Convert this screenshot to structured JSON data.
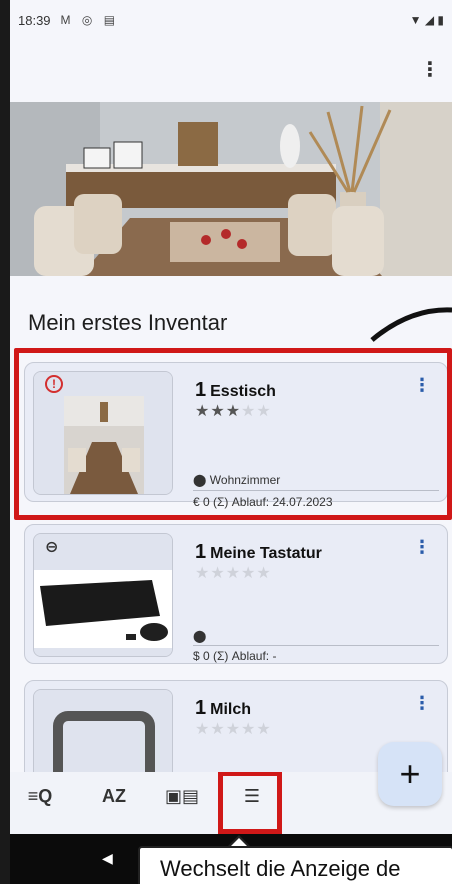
{
  "status_bar": {
    "time": "18:39",
    "notification_icons": [
      "gmail-icon",
      "alert-circle-icon",
      "calendar-icon"
    ],
    "system_icons": [
      "wifi-icon",
      "signal-icon",
      "battery-icon"
    ]
  },
  "app_bar": {
    "menu_icon": "more-vert-icon"
  },
  "title": "Mein erstes Inventar",
  "items": [
    {
      "count": "1",
      "name": "Esstisch",
      "rating": 3,
      "max_rating": 5,
      "badge": "alert-icon",
      "location": "Wohnzimmer",
      "meta": "€ 0  (Σ)   Ablauf: 24.07.2023"
    },
    {
      "count": "1",
      "name": "Meine Tastatur",
      "rating": 0,
      "max_rating": 5,
      "badge": "link-icon",
      "location": "",
      "meta": "$ 0  (Σ)   Ablauf: -"
    },
    {
      "count": "1",
      "name": "Milch",
      "rating": 0,
      "max_rating": 5,
      "badge": ""
    }
  ],
  "fab": {
    "label": "+"
  },
  "bottom_bar": {
    "items": [
      {
        "label": "≡Q",
        "icon": "filter-search-icon"
      },
      {
        "label": "AZ",
        "icon": "sort-az-icon"
      },
      {
        "label": "▣▤",
        "icon": "view-gallery-icon"
      },
      {
        "label": "☰",
        "icon": "view-list-icon"
      }
    ]
  },
  "tooltip": {
    "text": "Wechselt die Anzeige de"
  },
  "colors": {
    "highlight": "#d01818",
    "accent": "#2a5caa",
    "card_bg": "#e9ecf6",
    "fab_bg": "#d6e3f7"
  }
}
